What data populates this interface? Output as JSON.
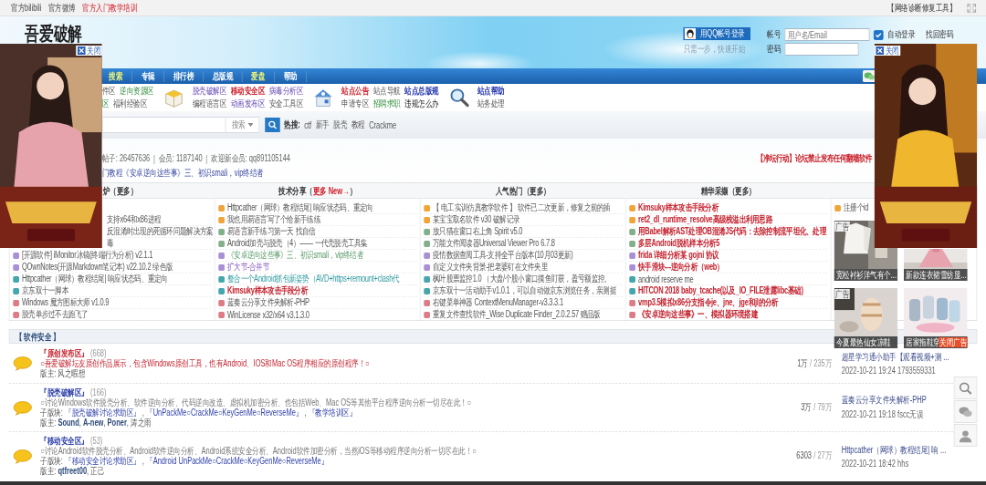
{
  "top_bar": {
    "links": [
      {
        "text": "官方bilibili",
        "kind": "plain"
      },
      {
        "text": "官方微博",
        "kind": "plain"
      },
      {
        "text": "官方入门教学培训",
        "kind": "hot"
      }
    ],
    "tool": "【网络诊断修复工具】"
  },
  "header": {
    "logo": "吾爱破解",
    "qq_login": "用QQ帐号登录",
    "qq_hint": "只需一步，快速开始",
    "login": {
      "account_label": "帐号",
      "account_placeholder": "用户名/Email",
      "auto_login": {
        "label": "自动登录",
        "checked": true
      },
      "forgot": "找回密码",
      "password_label": "密码"
    }
  },
  "nav": [
    {
      "label": "搜索",
      "highlight": true
    },
    {
      "label": "专辑",
      "highlight": false
    },
    {
      "label": "排行榜",
      "highlight": false
    },
    {
      "label": "总版规",
      "highlight": false
    },
    {
      "label": "爱盘",
      "highlight": true
    },
    {
      "label": "帮助",
      "highlight": false
    }
  ],
  "quick_links": [
    {
      "kind": "plain",
      "rows": [
        [
          {
            "text": "件区",
            "kind": "plain"
          },
          {
            "text": "逆向资源区",
            "kind": "green"
          }
        ],
        [
          {
            "text": "区",
            "kind": "green"
          },
          {
            "text": "福利经验区",
            "kind": "plain"
          }
        ]
      ]
    },
    {
      "kind": "box",
      "rows": [
        [
          {
            "text": "脱壳破解区",
            "kind": "purple"
          },
          {
            "text": "移动安全区",
            "kind": "red"
          },
          {
            "text": "病毒分析区",
            "kind": "purple"
          }
        ],
        [
          {
            "text": "编程语言区",
            "kind": "plain"
          },
          {
            "text": "动画发布区",
            "kind": "purple"
          },
          {
            "text": "安全工具区",
            "kind": "plain"
          }
        ]
      ]
    },
    {
      "kind": "house",
      "rows": [
        [
          {
            "text": "站点公告",
            "kind": "red"
          },
          {
            "text": "站点导航",
            "kind": "plain"
          },
          {
            "text": "站点总版规",
            "kind": "blue"
          }
        ],
        [
          {
            "text": "申请专区",
            "kind": "plain"
          },
          {
            "text": "招聘求职",
            "kind": "green"
          },
          {
            "text": "违规怎么办",
            "kind": "dark"
          }
        ]
      ]
    },
    {
      "kind": "magnifier",
      "rows": [
        [
          {
            "text": "站点帮助",
            "kind": "blue"
          }
        ],
        [
          {
            "text": "站务处理",
            "kind": "plain"
          }
        ]
      ]
    }
  ],
  "search": {
    "scope": "搜索",
    "hot_label": "热搜:",
    "hot": [
      "ctf",
      "新手",
      "脱壳",
      "教程",
      "Crackme"
    ]
  },
  "stats": {
    "items": [
      "帖子: 26457636",
      "会员: 1187140",
      "欢迎新会员: qq891105144"
    ],
    "separator": "|",
    "notice": "【净坛行动】论坛禁止发布任何翻墙软件",
    "announcement": "门教程《安卓逆向这些事》三、初识smali，vip终结者"
  },
  "table": {
    "columns": [
      {
        "heading": "炉（更多）",
        "rows": [
          {
            "text": "支持x64和x86进程",
            "kind": "partial"
          },
          {
            "text": "反混淆时出现的死循环问题解决方案",
            "kind": "partial"
          },
          {
            "text": "毒",
            "kind": "partial"
          },
          {
            "text": "[开源软件] iMonitor冰镜(终端行为分析) v2.1.1",
            "kind": "plain",
            "color": "#a98fd6"
          },
          {
            "text": "QOwnNotes(开源Markdown笔记本) v22.10.2 绿色版",
            "kind": "plain",
            "color": "#a98fd6"
          },
          {
            "text": "Httpcather（网球）教程结尾| 响应状态码、重定向",
            "kind": "plain",
            "color": "#45a6ad"
          },
          {
            "text": "京东双十一脚本",
            "kind": "plain",
            "color": "#45a6ad"
          },
          {
            "text": "Windows 魔方图标大师 v1.0.9",
            "kind": "plain",
            "color": "#de7c86"
          },
          {
            "text": "脱壳单步过不去跑飞了",
            "kind": "plain",
            "color": "#de7c86"
          }
        ]
      },
      {
        "heading": "技术分享（**更多 New→**）",
        "rows": [
          {
            "text": "Httpcather（网球）教程结尾| 响应状态码、重定向",
            "kind": "plain",
            "color": "#f0a43a"
          },
          {
            "text": "我也用易语言写了个给新手练练",
            "kind": "plain",
            "color": "#f0a43a"
          },
          {
            "text": "易语言新手练习第一天 找自信",
            "kind": "plain",
            "color": "#82b08a"
          },
          {
            "text": "Android加壳与脱壳（4）—— 一代壳脱壳工具集",
            "kind": "plain",
            "color": "#82b08a"
          },
          {
            "text": "《安卓逆向这些事》三、初识smali，vip终结者",
            "kind": "green",
            "color": "#a98fd6"
          },
          {
            "text": "扩大节-合并节",
            "kind": "purple",
            "color": "#a98fd6"
          },
          {
            "text": "整合一个Android抓包新姿势（AVD+https+remount+clash代",
            "kind": "teal",
            "color": "#45a6ad"
          },
          {
            "text": "Kimsuky样本攻击手段分析",
            "kind": "hot",
            "color": "#45a6ad"
          },
          {
            "text": "蓝奏云分享文件夹解析-PHP",
            "kind": "plain",
            "color": "#de7c86"
          },
          {
            "text": "WinLicense x32/x64 v3.1.3.0",
            "kind": "plain",
            "color": "#de7c86"
          }
        ]
      },
      {
        "heading": "人气热门（更多）",
        "rows": [
          {
            "text": "【 电工实训仿真教学软件 】 软件已二次更新，修复之前的插",
            "kind": "plain",
            "color": "#f0a43a"
          },
          {
            "text": "某宝宝取名软件 v30 破解记录",
            "kind": "plain",
            "color": "#f0a43a"
          },
          {
            "text": "放只猫在窗口右上角 Spirit v5.0",
            "kind": "plain",
            "color": "#82b08a"
          },
          {
            "text": "万能文件阅读器Universal Viewer Pro 6.7.8",
            "kind": "plain",
            "color": "#82b08a"
          },
          {
            "text": "疫情数据查阅工具-支持全平台版本(10月03更新)",
            "kind": "plain",
            "color": "#a98fd6"
          },
          {
            "text": "自定义文件夹背景-把老婆钉在文件夹里",
            "kind": "plain",
            "color": "#a98fd6"
          },
          {
            "text": "枫叶股票监控1.0 （大盘/个股小窗口摸鱼盯获，盈亏额监控,",
            "kind": "plain",
            "color": "#45a6ad"
          },
          {
            "text": "京东双十一活动助手v1.0.1，可以自动做京东浏览任务，亲测挺",
            "kind": "plain",
            "color": "#45a6ad"
          },
          {
            "text": "右键菜单神器 ContextMenuManager-v3.3.3.1",
            "kind": "plain",
            "color": "#de7c86"
          },
          {
            "text": "重复文件查找软件_Wise Duplicate Finder_2.0.2.57 赠品版",
            "kind": "plain",
            "color": "#de7c86"
          }
        ]
      },
      {
        "heading": "精华采撷（更多）",
        "rows": [
          {
            "text": "Kimsuky样本攻击手段分析",
            "kind": "hot",
            "color": "#f0a43a"
          },
          {
            "text": "ret2_dl_runtime_resolve高级栈溢出利用思路",
            "kind": "hot",
            "color": "#f0a43a"
          },
          {
            "text": "用Babel解析AST处理OB混淆JS代码：去除控制流平坦化、处理",
            "kind": "hot",
            "color": "#82b08a"
          },
          {
            "text": "多层Android脱机样本分析5",
            "kind": "hot",
            "color": "#82b08a"
          },
          {
            "text": "frida 详细分析某 gojni 协议",
            "kind": "hot",
            "color": "#a98fd6"
          },
          {
            "text": "快手滑块---逆向分析（web）",
            "kind": "hot",
            "color": "#a98fd6"
          },
          {
            "text": "android reserve me",
            "kind": "plain",
            "color": "#45a6ad"
          },
          {
            "text": "HITCON 2018 baby_tcache(以及_IO_FILE泄露libc基础)",
            "kind": "hot",
            "color": "#45a6ad"
          },
          {
            "text": "vmp3.5模拟x86分支指令je、jne、jge和jl的分析",
            "kind": "hot",
            "color": "#de7c86"
          },
          {
            "text": "《安卓逆向这些事》一、模拟器环境搭建",
            "kind": "hot",
            "color": "#de7c86"
          }
        ]
      },
      {
        "rows": [
          {
            "text": "注册个id",
            "kind": "plain",
            "color": "#f0a43a"
          }
        ],
        "ad_grid": [
          {
            "caption": "宽松衬衫洋气有个...",
            "tag": "广告",
            "kind": "shirt"
          },
          {
            "caption": "新款连衣裙雪纺显...",
            "kind": "dress"
          },
          {
            "caption": "今夏最热仙女凉鞋",
            "tag": "广告",
            "kind": "sandal"
          },
          {
            "caption": "居家拖鞋穿",
            "badge": "关闭广告",
            "kind": "slipper"
          }
        ]
      }
    ]
  },
  "forums": {
    "section": "【 软件安全 】",
    "boards": [
      {
        "kind": "featured",
        "title": "『原创发布区』",
        "count": "(668)",
        "description": "○吾爱破解坛友原创作品展示，包含Windows原创工具，也有Android、IOS和Mac OS程序相应的原创程序！○",
        "moderators": "版主: 风之暇想",
        "topics": "1万",
        "posts": "/ 235万",
        "last_post": "超星学习通小助手【观看视频+测 ...",
        "last_meta": "2022-10-21 19:24 1793559331"
      },
      {
        "kind": "normal",
        "title": "『脱壳破解区』",
        "count": "(166)",
        "description": "○讨论Windows软件脱壳分析、软件逆向分析、代码逆向改造、虚拟机加密分析、也包括Web、Mac OS等其他平台程序逆向分析一切尽在此！○",
        "sub": {
          "label": "子版块:",
          "separator": ",",
          "links": [
            "『脱壳破解讨论求助区』",
            "『UnPackMe○CrackMe○KeyGenMe○ReverseMe』",
            "『教学培训区』"
          ]
        },
        "moderators": "版主: **Sound**, **A-new**, **Poner**, 涛之雨",
        "topics": "3万",
        "posts": "/ 79万",
        "last_post": "蓝奏云分享文件夹解析-PHP",
        "last_meta": "2022-10-21 19:18 fscc无误"
      },
      {
        "kind": "normal",
        "title": "『移动安全区』",
        "count": "(53)",
        "description": "○讨论Android软件脱壳分析、Android软件逆向分析、Android系统安全分析、Android软件加密分析，当然iOS等移动程序逆向分析一切尽在此！○",
        "sub": {
          "label": "子版块:",
          "separator": ",",
          "links": [
            "『移动安全讨论求助区』",
            "『Android UnPackMe○CrackMe○KeyGenMe○ReverseMe』"
          ]
        },
        "moderators": "版主: **qtfreet00**, 正己",
        "topics": "6303",
        "posts": "/ 27万",
        "last_post": "Httpcather（网球）教程结尾| 响 ...",
        "last_meta": "2022-10-21 18:42 hhs"
      }
    ]
  },
  "ads": [
    {
      "close": "关闭"
    },
    {
      "close": "关闭"
    }
  ]
}
